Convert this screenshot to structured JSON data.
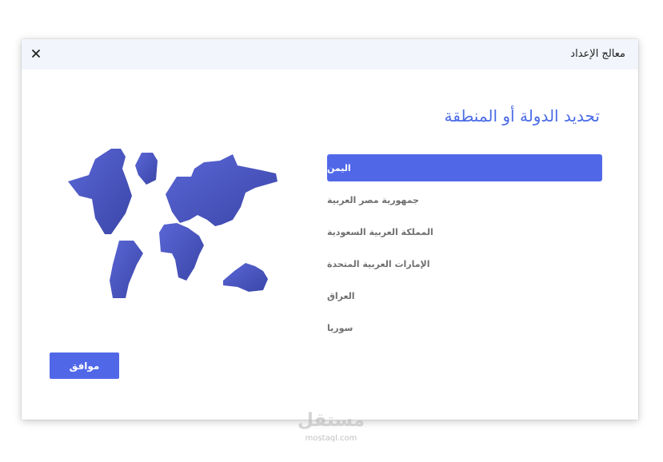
{
  "window": {
    "title": "معالج الإعداد",
    "close_icon": "close-icon"
  },
  "main": {
    "heading": "تحديد الدولة أو المنطقة",
    "countries": [
      {
        "label": "اليمن",
        "selected": true
      },
      {
        "label": "جمهورية مصر العربية",
        "selected": false
      },
      {
        "label": "المملكة العربية السعودية",
        "selected": false
      },
      {
        "label": "الإمارات العربية المتحدة",
        "selected": false
      },
      {
        "label": "العراق",
        "selected": false
      },
      {
        "label": "سوريا",
        "selected": false
      }
    ],
    "illustration_icon": "world-map-icon",
    "ok_label": "موافق"
  },
  "watermark": {
    "logo_text": "مستقل",
    "text": "mostaql.com"
  },
  "colors": {
    "accent": "#5068e8",
    "heading": "#4b6ce6",
    "titlebar": "#f2f5fb",
    "map_light": "#5a66d6",
    "map_dark": "#3b46a8"
  }
}
